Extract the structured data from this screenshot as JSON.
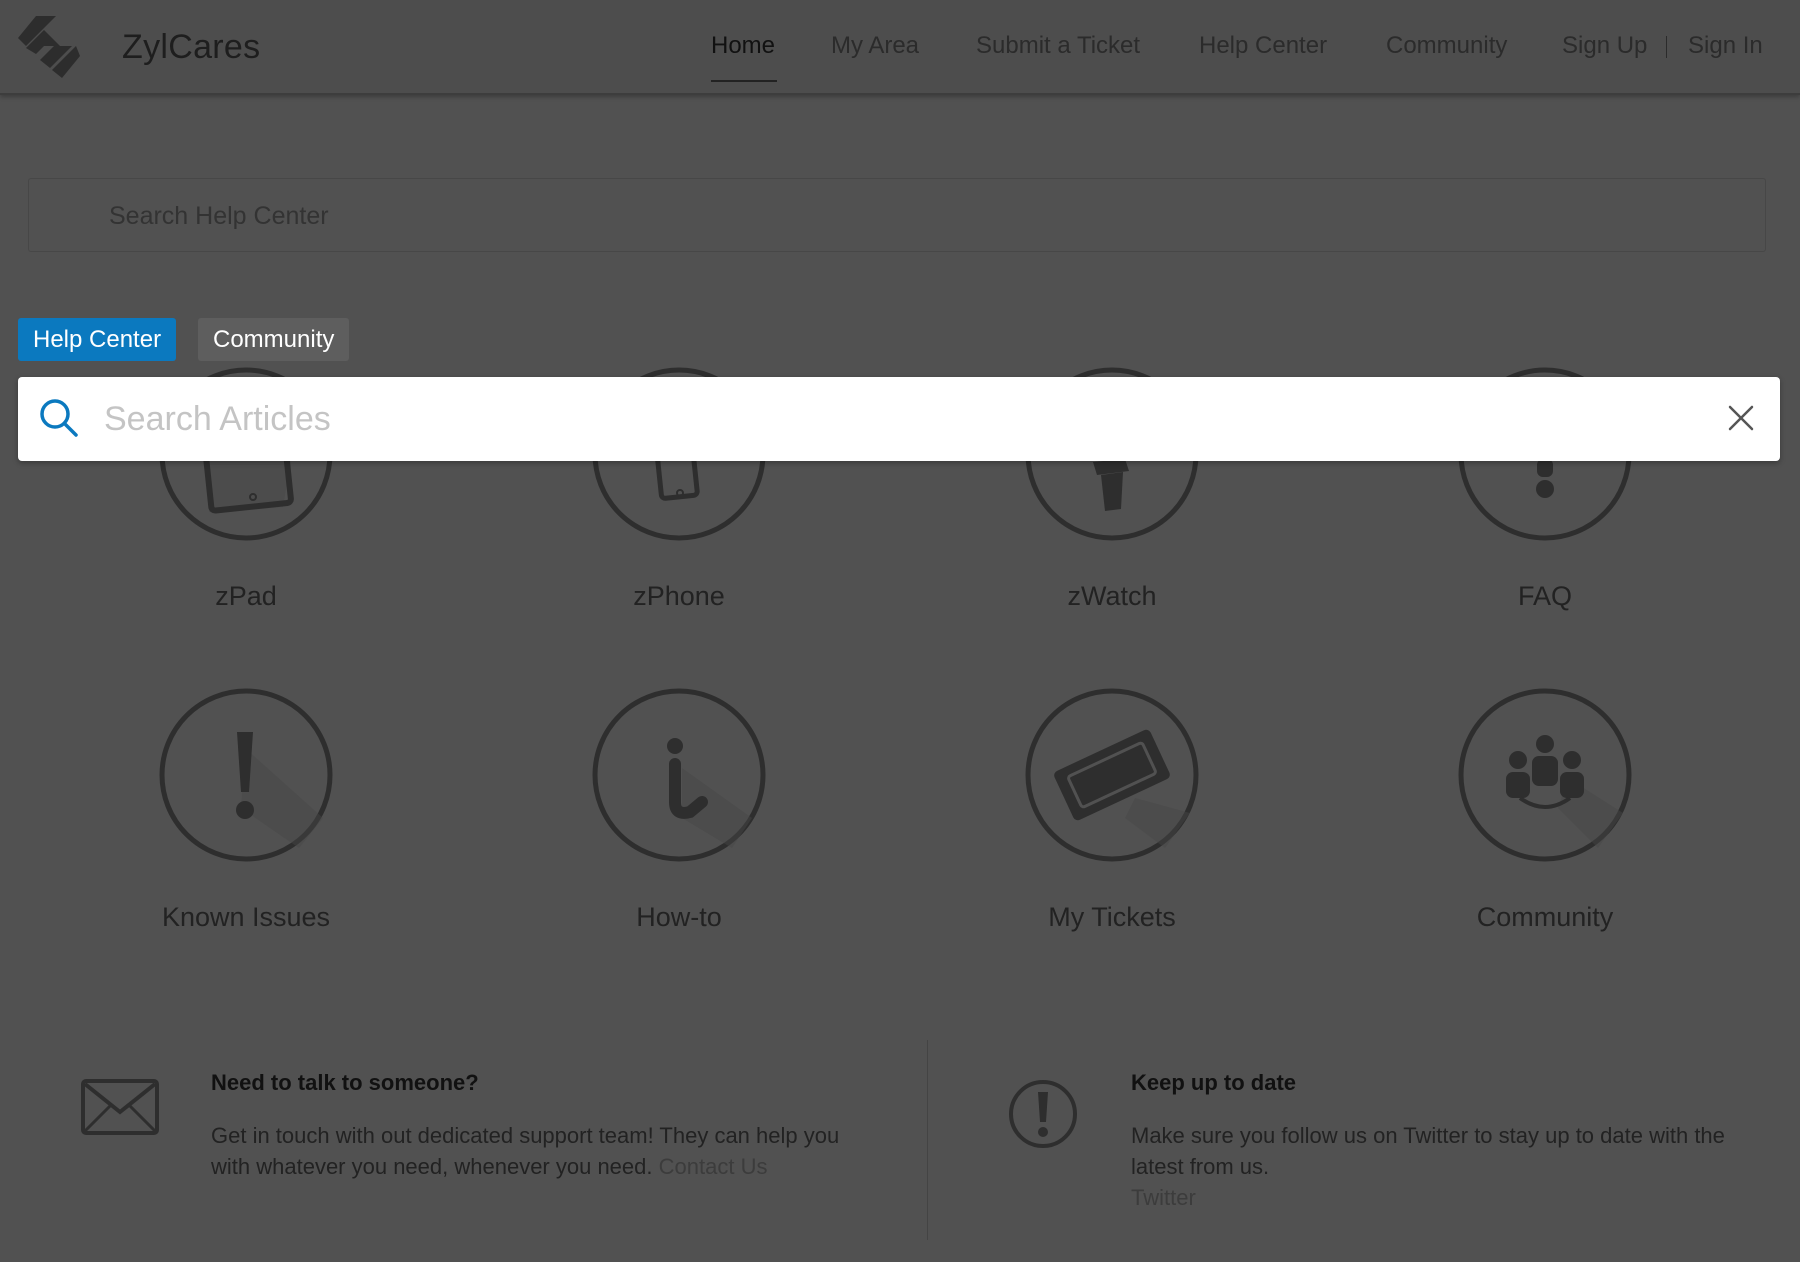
{
  "header": {
    "brand": "ZylCares",
    "nav": [
      {
        "label": "Home",
        "active": true
      },
      {
        "label": "My Area"
      },
      {
        "label": "Submit a Ticket"
      },
      {
        "label": "Help Center"
      },
      {
        "label": "Community"
      },
      {
        "label": "Sign Up"
      },
      {
        "label": "Sign In"
      }
    ]
  },
  "background_search": {
    "placeholder": "Search Help Center"
  },
  "tabs": [
    {
      "label": "Help Center",
      "active": true
    },
    {
      "label": "Community",
      "active": false
    }
  ],
  "overlay_search": {
    "placeholder": "Search Articles",
    "value": ""
  },
  "categories": [
    {
      "label": "zPad",
      "icon": "tablet-icon"
    },
    {
      "label": "zPhone",
      "icon": "phone-icon"
    },
    {
      "label": "zWatch",
      "icon": "watch-icon"
    },
    {
      "label": "FAQ",
      "icon": "question-icon"
    },
    {
      "label": "Known Issues",
      "icon": "exclamation-icon"
    },
    {
      "label": "How-to",
      "icon": "info-icon"
    },
    {
      "label": "My Tickets",
      "icon": "ticket-icon"
    },
    {
      "label": "Community",
      "icon": "people-icon"
    }
  ],
  "footer": {
    "contact": {
      "title": "Need to talk to someone?",
      "text": "Get in touch with out dedicated support team! They can help you with whatever you need, whenever you need.",
      "link": "Contact Us"
    },
    "updates": {
      "title": "Keep up to date",
      "text": "Make sure you follow us on Twitter to stay up to date with the latest from us.",
      "link": "Twitter"
    }
  },
  "colors": {
    "accent": "#0b79bf",
    "overlay_dim": "#515151",
    "icon_stroke": "#2e2e2e"
  }
}
